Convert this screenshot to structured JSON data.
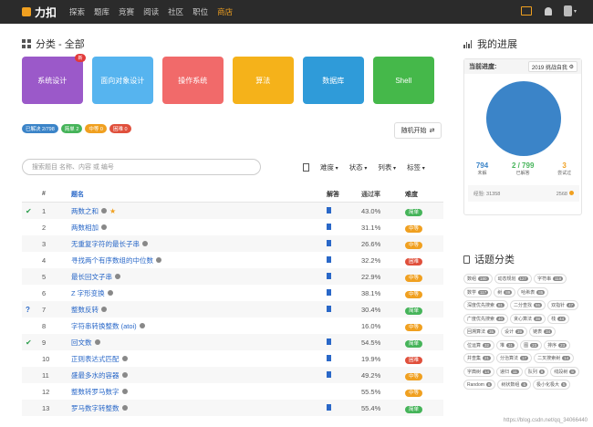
{
  "nav": {
    "brand": "力扣",
    "links": [
      {
        "label": "探索",
        "active": false
      },
      {
        "label": "题库",
        "active": false
      },
      {
        "label": "竞赛",
        "active": false
      },
      {
        "label": "阅读",
        "active": false
      },
      {
        "label": "社区",
        "active": false
      },
      {
        "label": "职位",
        "active": false
      },
      {
        "label": "商店",
        "active": true
      }
    ]
  },
  "page": {
    "title": "分类 - 全部"
  },
  "categories": [
    {
      "label": "系统设计",
      "color": "#9b59c9",
      "badge": "新"
    },
    {
      "label": "面向对象设计",
      "color": "#56b4ef",
      "badge": ""
    },
    {
      "label": "操作系统",
      "color": "#f16a6a",
      "badge": ""
    },
    {
      "label": "算法",
      "color": "#f5b21a",
      "badge": ""
    },
    {
      "label": "数据库",
      "color": "#2f9bd9",
      "badge": ""
    },
    {
      "label": "Shell",
      "color": "#45b84a",
      "badge": ""
    }
  ],
  "status_pills": [
    {
      "label": "已解决 2/798",
      "color": "#3b84c8"
    },
    {
      "label": "简单 2",
      "color": "#46b45a"
    },
    {
      "label": "中等 0",
      "color": "#f0a020"
    },
    {
      "label": "困难 0",
      "color": "#e0503c"
    }
  ],
  "random_button": "随机开始",
  "search": {
    "placeholder": "搜索题目 名称、内容 或 编号"
  },
  "filters": [
    "难度",
    "状态",
    "列表",
    "标签"
  ],
  "table": {
    "headers": {
      "num": "#",
      "title": "题名",
      "solution": "解答",
      "rate": "通过率",
      "difficulty": "难度"
    },
    "rows": [
      {
        "status": "check",
        "num": "1",
        "title": "两数之和",
        "star": true,
        "sol": true,
        "rate": "43.0%",
        "diff": "简单",
        "diff_color": "#46b45a"
      },
      {
        "status": "",
        "num": "2",
        "title": "两数相加",
        "star": false,
        "sol": true,
        "rate": "31.1%",
        "diff": "中等",
        "diff_color": "#f0a020"
      },
      {
        "status": "",
        "num": "3",
        "title": "无重复字符的最长子串",
        "star": false,
        "sol": true,
        "rate": "26.6%",
        "diff": "中等",
        "diff_color": "#f0a020"
      },
      {
        "status": "",
        "num": "4",
        "title": "寻找两个有序数组的中位数",
        "star": false,
        "sol": true,
        "rate": "32.2%",
        "diff": "困难",
        "diff_color": "#e0503c"
      },
      {
        "status": "",
        "num": "5",
        "title": "最长回文子串",
        "star": false,
        "sol": true,
        "rate": "22.9%",
        "diff": "中等",
        "diff_color": "#f0a020"
      },
      {
        "status": "",
        "num": "6",
        "title": "Z 字形变换",
        "star": false,
        "sol": true,
        "rate": "38.1%",
        "diff": "中等",
        "diff_color": "#f0a020"
      },
      {
        "status": "q",
        "num": "7",
        "title": "整数反转",
        "star": false,
        "sol": true,
        "rate": "30.4%",
        "diff": "简单",
        "diff_color": "#46b45a"
      },
      {
        "status": "",
        "num": "8",
        "title": "字符串转换整数 (atoi)",
        "star": false,
        "sol": false,
        "rate": "16.0%",
        "diff": "中等",
        "diff_color": "#f0a020"
      },
      {
        "status": "check",
        "num": "9",
        "title": "回文数",
        "star": false,
        "sol": true,
        "rate": "54.5%",
        "diff": "简单",
        "diff_color": "#46b45a"
      },
      {
        "status": "",
        "num": "10",
        "title": "正则表达式匹配",
        "star": false,
        "sol": true,
        "rate": "19.9%",
        "diff": "困难",
        "diff_color": "#e0503c"
      },
      {
        "status": "",
        "num": "11",
        "title": "盛最多水的容器",
        "star": false,
        "sol": true,
        "rate": "49.2%",
        "diff": "中等",
        "diff_color": "#f0a020"
      },
      {
        "status": "",
        "num": "12",
        "title": "整数转罗马数字",
        "star": false,
        "sol": false,
        "rate": "55.5%",
        "diff": "中等",
        "diff_color": "#f0a020"
      },
      {
        "status": "",
        "num": "13",
        "title": "罗马数字转整数",
        "star": false,
        "sol": true,
        "rate": "55.4%",
        "diff": "简单",
        "diff_color": "#46b45a"
      }
    ]
  },
  "progress": {
    "title": "我的进展",
    "current_label": "当前进度:",
    "select_value": "2019 挑战自我",
    "stats": [
      {
        "value": "794",
        "label": "未解",
        "color": "#3b84c8"
      },
      {
        "value": "2 / 799",
        "label": "已解答",
        "color": "#46b45a"
      },
      {
        "value": "3",
        "label": "尝试过",
        "color": "#f0a020"
      }
    ],
    "footer_left": "经验: 31358",
    "footer_right": "2568"
  },
  "tags_section": {
    "title": "话题分类",
    "tags": [
      {
        "label": "数组",
        "count": "180"
      },
      {
        "label": "动态规划",
        "count": "127"
      },
      {
        "label": "字符串",
        "count": "119"
      },
      {
        "label": "数学",
        "count": "117"
      },
      {
        "label": "树",
        "count": "89"
      },
      {
        "label": "哈希表",
        "count": "85"
      },
      {
        "label": "深度优先搜索",
        "count": "81"
      },
      {
        "label": "二分查找",
        "count": "55"
      },
      {
        "label": "双指针",
        "count": "47"
      },
      {
        "label": "广度优先搜索",
        "count": "40"
      },
      {
        "label": "贪心算法",
        "count": "38"
      },
      {
        "label": "栈",
        "count": "44"
      },
      {
        "label": "回溯算法",
        "count": "35"
      },
      {
        "label": "设计",
        "count": "39"
      },
      {
        "label": "链表",
        "count": "34"
      },
      {
        "label": "位运算",
        "count": "32"
      },
      {
        "label": "堆",
        "count": "31"
      },
      {
        "label": "图",
        "count": "23"
      },
      {
        "label": "排序",
        "count": "23"
      },
      {
        "label": "并查集",
        "count": "21"
      },
      {
        "label": "分治算法",
        "count": "17"
      },
      {
        "label": "二叉搜索树",
        "count": "14"
      },
      {
        "label": "字典树",
        "count": "14"
      },
      {
        "label": "递归",
        "count": "11"
      },
      {
        "label": "队列",
        "count": "9"
      },
      {
        "label": "线段树",
        "count": "9"
      },
      {
        "label": "Random",
        "count": "6"
      },
      {
        "label": "树状数组",
        "count": "6"
      },
      {
        "label": "极小化极大",
        "count": "5"
      }
    ]
  },
  "watermark": "https://blog.csdn.net/qq_34066440"
}
